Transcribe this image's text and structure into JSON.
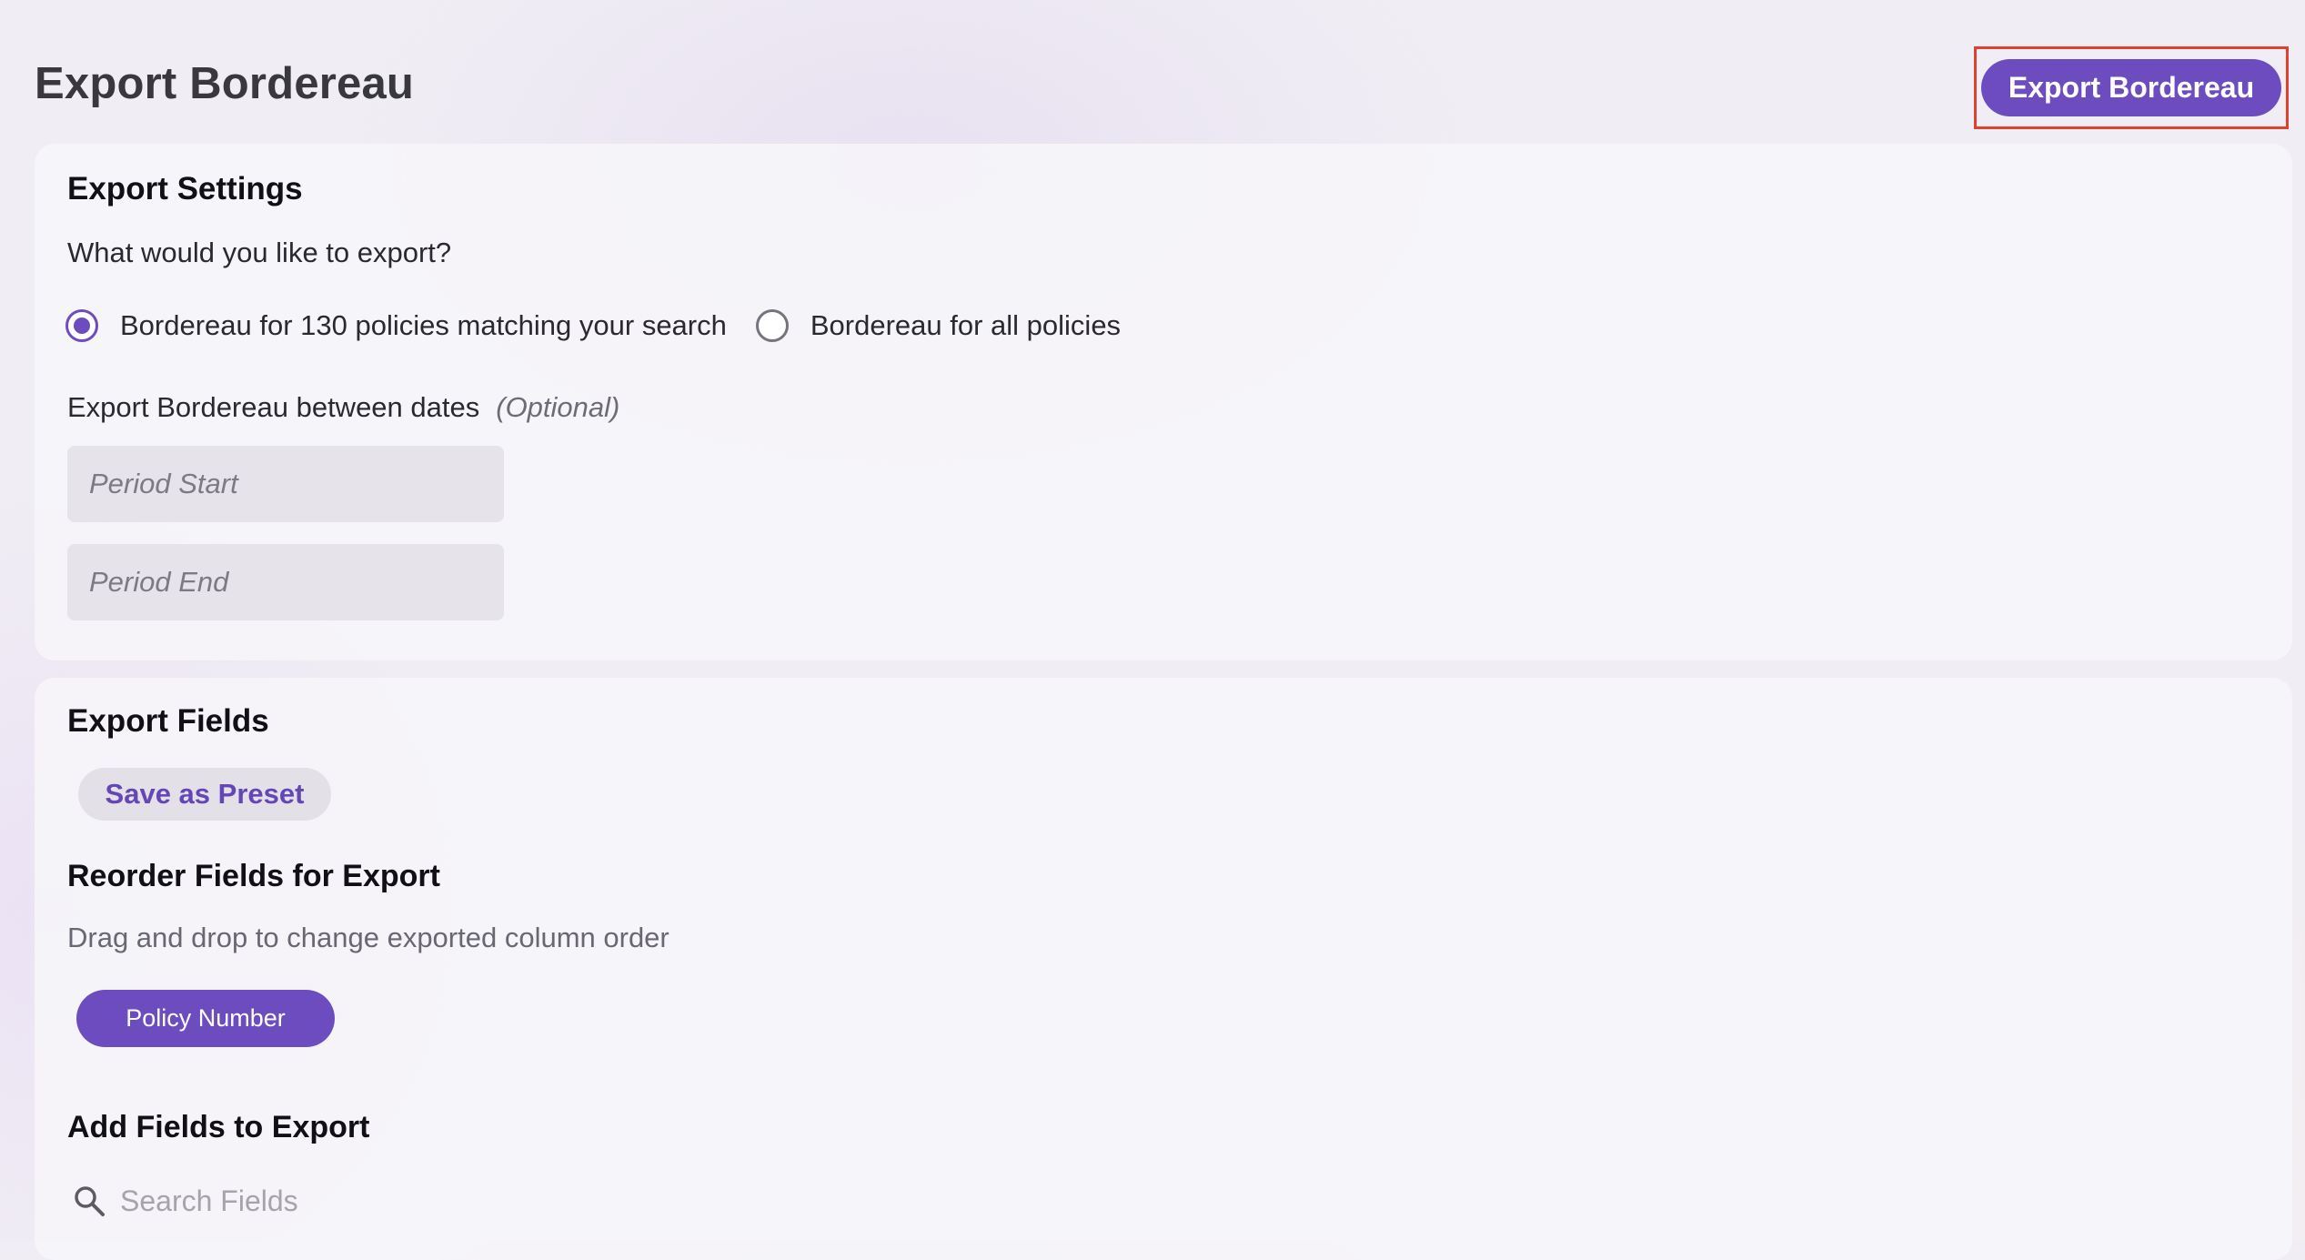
{
  "page": {
    "title": "Export Bordereau",
    "export_button_label": "Export Bordereau"
  },
  "colors": {
    "accent": "#6d4cc0",
    "highlight_border": "#e0412c"
  },
  "export_settings": {
    "title": "Export Settings",
    "question": "What would you like to export?",
    "options": [
      {
        "label": "Bordereau for 130 policies matching your search",
        "selected": true
      },
      {
        "label": "Bordereau for all policies",
        "selected": false
      }
    ],
    "dates_label": "Export Bordereau between dates",
    "dates_optional": "(Optional)",
    "period_start": {
      "value": "",
      "placeholder": "Period Start"
    },
    "period_end": {
      "value": "",
      "placeholder": "Period End"
    }
  },
  "export_fields": {
    "title": "Export Fields",
    "save_preset_label": "Save as Preset",
    "reorder_title": "Reorder Fields for Export",
    "reorder_helper": "Drag and drop to change exported column order",
    "selected_fields": [
      "Policy Number"
    ],
    "add_title": "Add Fields to Export",
    "search": {
      "value": "",
      "placeholder": "Search Fields",
      "icon": "search-icon"
    }
  }
}
